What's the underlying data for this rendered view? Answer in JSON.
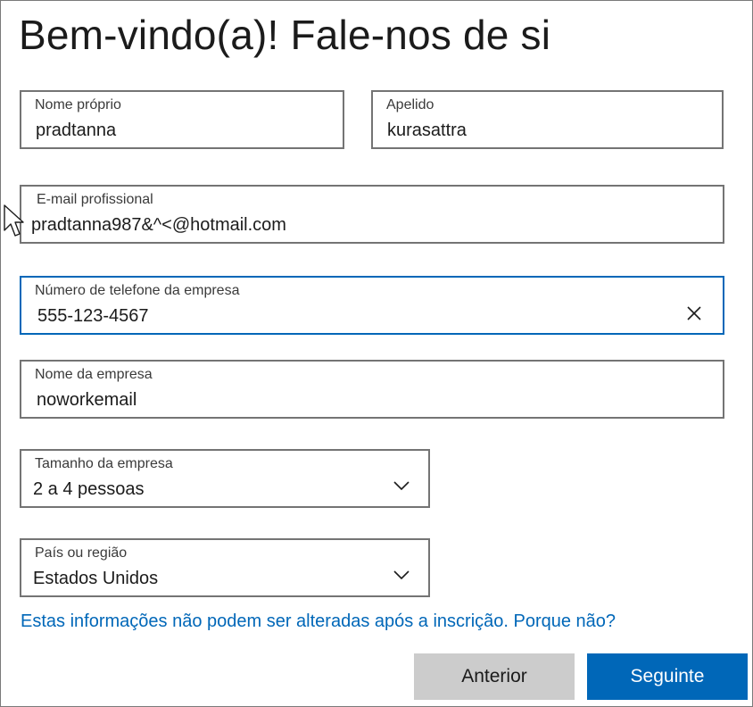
{
  "title": "Bem-vindo(a)! Fale-nos de si",
  "form": {
    "first_name": {
      "label": "Nome próprio",
      "value": "pradtanna"
    },
    "last_name": {
      "label": "Apelido",
      "value": "kurasattra"
    },
    "work_email": {
      "label": "E-mail profissional",
      "value": "pradtanna987&^<@hotmail.com"
    },
    "phone": {
      "label": "Número de telefone da empresa",
      "value": "555-123-4567"
    },
    "company_name": {
      "label": "Nome da empresa",
      "value": "noworkemail"
    },
    "company_size": {
      "label": "Tamanho da empresa",
      "value": "2 a 4 pessoas"
    },
    "country": {
      "label": "País ou região",
      "value": "Estados Unidos"
    }
  },
  "info_link": "Estas informações não podem ser alteradas após a inscrição. Porque não?",
  "buttons": {
    "back": "Anterior",
    "next": "Seguinte"
  },
  "colors": {
    "accent": "#0067b8",
    "border": "#747474",
    "secondary_button": "#cccccc"
  },
  "icons": {
    "clear": "close-icon",
    "dropdown": "chevron-down-icon",
    "pointer": "mouse-cursor-icon"
  }
}
